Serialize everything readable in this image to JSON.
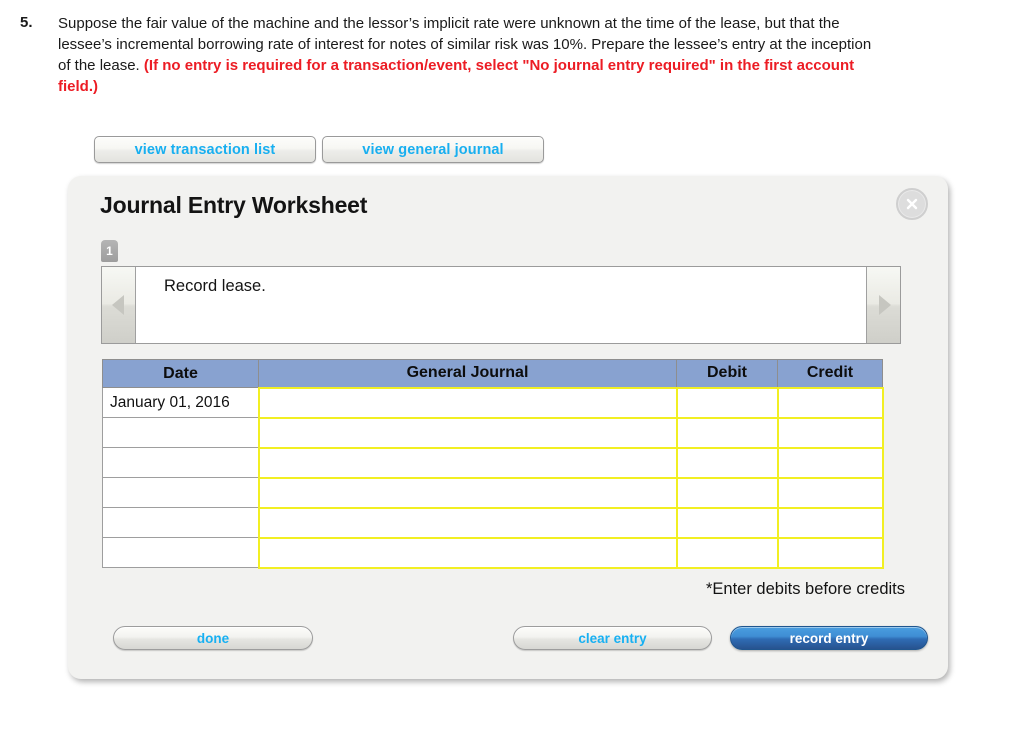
{
  "question": {
    "number": "5.",
    "text_part1": "Suppose the fair value of the machine and the lessor’s implicit rate were unknown at the time of the lease, but that the lessee’s incremental borrowing rate of interest for notes of similar risk was 10%. Prepare the lessee’s entry at the inception of the lease. ",
    "text_highlight": "(If no entry is required for a transaction/event, select \"No journal entry required\" in the first account field.)"
  },
  "toolbar": {
    "view_transaction_list": "view transaction list",
    "view_general_journal": "view general journal"
  },
  "panel": {
    "title": "Journal Entry Worksheet",
    "close_icon": "close-icon",
    "tab_badge": "1",
    "prev_icon": "triangle-left-icon",
    "next_icon": "triangle-right-icon",
    "prompt": "Record lease.",
    "note": "*Enter debits before credits"
  },
  "table": {
    "columns": [
      "Date",
      "General Journal",
      "Debit",
      "Credit"
    ],
    "rows": [
      {
        "date": "January 01, 2016",
        "general_journal": "",
        "debit": "",
        "credit": ""
      },
      {
        "date": "",
        "general_journal": "",
        "debit": "",
        "credit": ""
      },
      {
        "date": "",
        "general_journal": "",
        "debit": "",
        "credit": ""
      },
      {
        "date": "",
        "general_journal": "",
        "debit": "",
        "credit": ""
      },
      {
        "date": "",
        "general_journal": "",
        "debit": "",
        "credit": ""
      },
      {
        "date": "",
        "general_journal": "",
        "debit": "",
        "credit": ""
      }
    ]
  },
  "actions": {
    "done": "done",
    "clear_entry": "clear entry",
    "record_entry": "record entry"
  },
  "colors": {
    "accent_cyan": "#18aff0",
    "header_blue": "#88a2d0",
    "field_yellow": "#f2ef23",
    "highlight_red": "#ec1c24",
    "record_blue": "#3f8ed4"
  }
}
